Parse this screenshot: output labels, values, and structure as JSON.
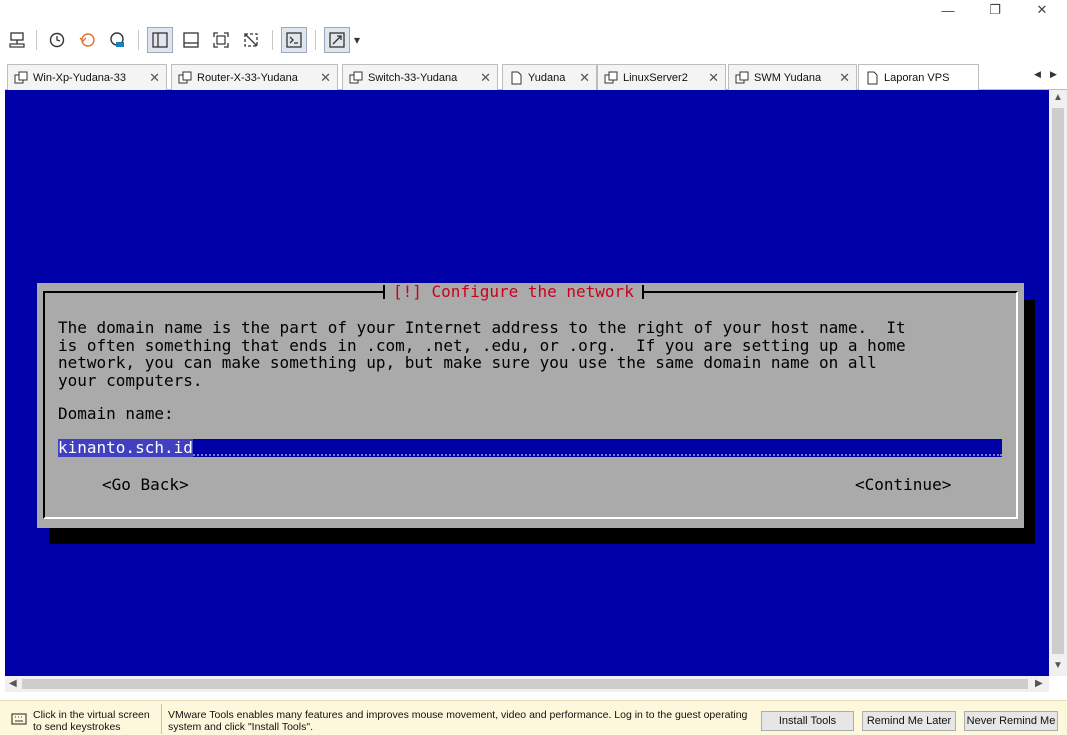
{
  "window": {
    "minimize_glyph": "—",
    "restore_glyph": "❐",
    "close_glyph": "✕"
  },
  "toolbar": {
    "icons": [
      "send-ctrl-alt-del-icon",
      "snapshot-icon",
      "revert-snapshot-icon",
      "snapshot-manager-icon",
      "library-view-icon",
      "thumbnail-bar-icon",
      "full-screen-icon",
      "unity-icon",
      "console-view-icon",
      "stretch-guest-icon"
    ],
    "dropdown_glyph": "▾"
  },
  "tabs": [
    {
      "label": "Win-Xp-Yudana-33",
      "icon": "vm-icon",
      "closable": true
    },
    {
      "label": "Router-X-33-Yudana",
      "icon": "vm-icon",
      "closable": true
    },
    {
      "label": "Switch-33-Yudana",
      "icon": "vm-icon",
      "closable": true
    },
    {
      "label": "Yudana",
      "icon": "document-icon",
      "closable": true
    },
    {
      "label": "LinuxServer2",
      "icon": "vm-icon",
      "closable": true
    },
    {
      "label": "SWM Yudana",
      "icon": "vm-icon",
      "closable": true
    },
    {
      "label": "Laporan VPS",
      "icon": "document-icon",
      "closable": false
    }
  ],
  "tab_close_glyph": "✕",
  "tab_nav": {
    "prev": "◀",
    "next": "▶"
  },
  "console": {
    "dialog_title": "[!] Configure the network",
    "description_lines": [
      "The domain name is the part of your Internet address to the right of your host name.  It",
      "is often something that ends in .com, .net, .edu, or .org.  If you are setting up a home",
      "network, you can make something up, but make sure you use the same domain name on all",
      "your computers."
    ],
    "field_label": "Domain name:",
    "field_value": "kinanto.sch.id",
    "go_back": "<Go Back>",
    "continue": "<Continue>"
  },
  "scroll": {
    "up": "▲",
    "down": "▼",
    "left": "◀",
    "right": "▶"
  },
  "statusbar": {
    "click_hint": "Click in the virtual screen to send keystrokes",
    "tools_message": "VMware Tools enables many features and improves mouse movement, video and performance. Log in to the guest operating system and click \"Install Tools\".",
    "install_tools": "Install Tools",
    "remind_later": "Remind Me Later",
    "never_remind": "Never Remind Me"
  },
  "colors": {
    "console_bg": "#0000a8",
    "dialog_bg": "#aaaaaa",
    "title_red": "#c8001e",
    "statusbar_bg": "#fdf7dc"
  }
}
